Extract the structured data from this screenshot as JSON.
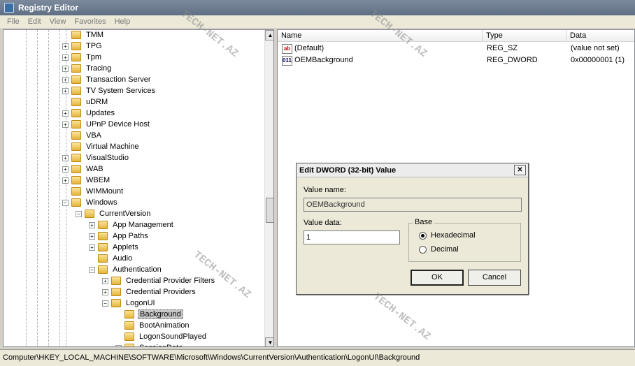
{
  "window": {
    "title": "Registry Editor"
  },
  "menu": [
    "File",
    "Edit",
    "View",
    "Favorites",
    "Help"
  ],
  "tree": {
    "items": [
      {
        "label": "TMM",
        "depth": 0,
        "expander": "none"
      },
      {
        "label": "TPG",
        "depth": 0,
        "expander": "plus"
      },
      {
        "label": "Tpm",
        "depth": 0,
        "expander": "plus"
      },
      {
        "label": "Tracing",
        "depth": 0,
        "expander": "plus"
      },
      {
        "label": "Transaction Server",
        "depth": 0,
        "expander": "plus"
      },
      {
        "label": "TV System Services",
        "depth": 0,
        "expander": "plus"
      },
      {
        "label": "uDRM",
        "depth": 0,
        "expander": "none"
      },
      {
        "label": "Updates",
        "depth": 0,
        "expander": "plus"
      },
      {
        "label": "UPnP Device Host",
        "depth": 0,
        "expander": "plus"
      },
      {
        "label": "VBA",
        "depth": 0,
        "expander": "none"
      },
      {
        "label": "Virtual Machine",
        "depth": 0,
        "expander": "none"
      },
      {
        "label": "VisualStudio",
        "depth": 0,
        "expander": "plus"
      },
      {
        "label": "WAB",
        "depth": 0,
        "expander": "plus"
      },
      {
        "label": "WBEM",
        "depth": 0,
        "expander": "plus"
      },
      {
        "label": "WIMMount",
        "depth": 0,
        "expander": "none"
      },
      {
        "label": "Windows",
        "depth": 0,
        "expander": "minus"
      },
      {
        "label": "CurrentVersion",
        "depth": 1,
        "expander": "minus"
      },
      {
        "label": "App Management",
        "depth": 2,
        "expander": "plus"
      },
      {
        "label": "App Paths",
        "depth": 2,
        "expander": "plus"
      },
      {
        "label": "Applets",
        "depth": 2,
        "expander": "plus"
      },
      {
        "label": "Audio",
        "depth": 2,
        "expander": "none"
      },
      {
        "label": "Authentication",
        "depth": 2,
        "expander": "minus"
      },
      {
        "label": "Credential Provider Filters",
        "depth": 3,
        "expander": "plus"
      },
      {
        "label": "Credential Providers",
        "depth": 3,
        "expander": "plus"
      },
      {
        "label": "LogonUI",
        "depth": 3,
        "expander": "minus"
      },
      {
        "label": "Background",
        "depth": 4,
        "expander": "none",
        "selected": true
      },
      {
        "label": "BootAnimation",
        "depth": 4,
        "expander": "none"
      },
      {
        "label": "LogonSoundPlayed",
        "depth": 4,
        "expander": "none"
      },
      {
        "label": "SessionData",
        "depth": 4,
        "expander": "plus"
      }
    ]
  },
  "list": {
    "columns": [
      "Name",
      "Type",
      "Data"
    ],
    "rows": [
      {
        "icon": "string-value-icon",
        "icon_text": "ab",
        "name": "(Default)",
        "type": "REG_SZ",
        "data": "(value not set)"
      },
      {
        "icon": "binary-value-icon",
        "icon_text": "011",
        "name": "OEMBackground",
        "type": "REG_DWORD",
        "data": "0x00000001 (1)"
      }
    ]
  },
  "dialog": {
    "title": "Edit DWORD (32-bit) Value",
    "close": "✕",
    "value_name_label": "Value name:",
    "value_name": "OEMBackground",
    "value_data_label": "Value data:",
    "value_data": "1",
    "base_label": "Base",
    "hex_label": "Hexadecimal",
    "dec_label": "Decimal",
    "base_selected": "Hexadecimal",
    "ok_label": "OK",
    "cancel_label": "Cancel"
  },
  "status": {
    "path": "Computer\\HKEY_LOCAL_MACHINE\\SOFTWARE\\Microsoft\\Windows\\CurrentVersion\\Authentication\\LogonUI\\Background"
  },
  "watermark": "TECH-NET.AZ",
  "colors": {
    "title_bar": "#6b7a8e",
    "selection": "#c8c8c8",
    "folder": "#e5b43d"
  }
}
